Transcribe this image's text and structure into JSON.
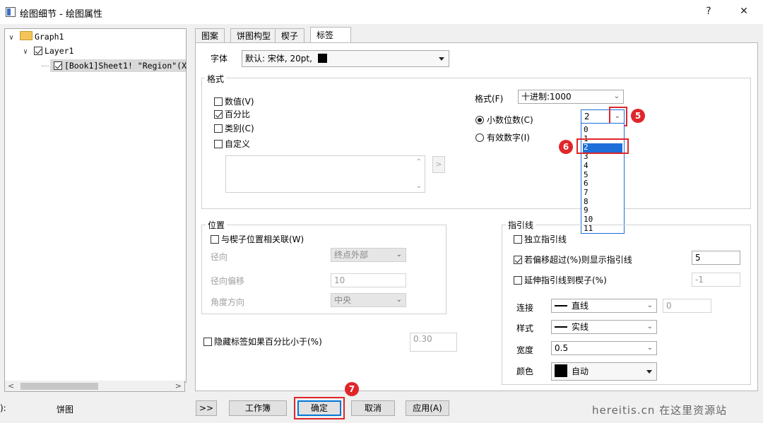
{
  "window": {
    "title": "绘图细节 - 绘图属性",
    "help": "?",
    "close": "✕"
  },
  "tree": {
    "graph": "Graph1",
    "layer": "Layer1",
    "plot": "[Book1]Sheet1! \"Region\"(X"
  },
  "tabs": [
    "图案",
    "饼图构型",
    "楔子",
    "标签"
  ],
  "font": {
    "label": "字体",
    "value": "默认: 宋体, 20pt,"
  },
  "format_group": {
    "title": "格式",
    "checks": [
      {
        "label": "数值(V)",
        "checked": false
      },
      {
        "label": "百分比",
        "checked": true
      },
      {
        "label": "类别(C)",
        "checked": false
      },
      {
        "label": "自定义",
        "checked": false
      }
    ],
    "format_label": "格式(F)",
    "format_value": "十进制:1000",
    "decimal_label": "小数位数(C)",
    "sigfig_label": "有效数字(I)",
    "decimal_value": "2",
    "decimal_options": [
      "0",
      "1",
      "2",
      "3",
      "4",
      "5",
      "6",
      "7",
      "8",
      "9",
      "10",
      "11"
    ],
    "selected_index": 2
  },
  "position_group": {
    "title": "位置",
    "link_label": "与楔子位置相关联(W)",
    "radial_label": "径向",
    "radial_value": "终点外部",
    "offset_label": "径向偏移",
    "offset_value": "10",
    "angle_label": "角度方向",
    "angle_value": "中央"
  },
  "hide_label": "隐藏标签如果百分比小于(%)",
  "hide_value": "0.30",
  "leader_group": {
    "title": "指引线",
    "independent": "独立指引线",
    "show_if_offset": "若偏移超过(%)则显示指引线",
    "show_if_offset_value": "5",
    "extend": "延伸指引线到楔子(%)",
    "extend_value": "-1",
    "connect_label": "连接",
    "connect_value": "直线",
    "connect_num": "0",
    "style_label": "样式",
    "style_value": "实线",
    "width_label": "宽度",
    "width_value": "0.5",
    "color_label": "颜色",
    "color_value": "自动"
  },
  "markers": {
    "m5": "5",
    "m6": "6",
    "m7": "7"
  },
  "bottom": {
    "left_label": "):",
    "left_value": "饼图",
    "expand": ">>",
    "workbook": "工作簿",
    "ok": "确定",
    "cancel": "取消",
    "apply": "应用(A)"
  },
  "watermark": "hereitis.cn 在这里资源站",
  "colors": {
    "accent": "#1e6fd9",
    "highlight_red": "#e0262a"
  }
}
